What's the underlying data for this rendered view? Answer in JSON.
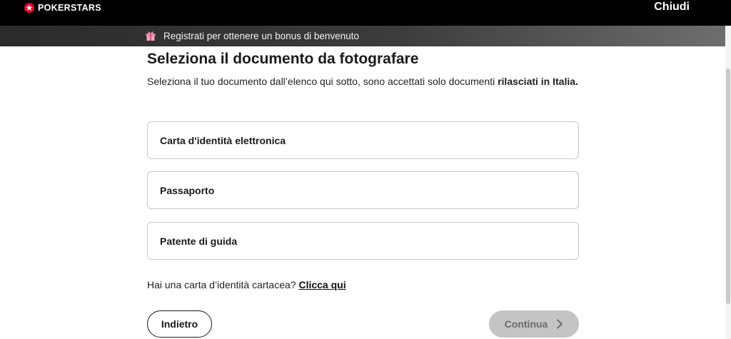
{
  "header": {
    "brand": "POKERSTARS",
    "close_label": "Chiudi"
  },
  "promo": {
    "text": "Registrati per ottenere un bonus di benvenuto"
  },
  "main": {
    "title": "Seleziona il documento da fotografare",
    "description_prefix": "Seleziona il tuo documento dall’elenco qui sotto, sono accettati solo documenti ",
    "description_bold": "rilasciati in Italia.",
    "options": [
      {
        "label": "Carta d'identità elettronica"
      },
      {
        "label": "Passaporto"
      },
      {
        "label": "Patente di guida"
      }
    ],
    "paper_id_question": "Hai una carta d’identità cartacea? ",
    "paper_id_link": "Clicca qui",
    "back_label": "Indietro",
    "continue_label": "Continua"
  },
  "colors": {
    "topbar_bg": "#000000",
    "brand_red": "#e4002b",
    "gift_pink": "#e88aa8",
    "continue_disabled_bg": "#c4c4c4"
  },
  "icons": {
    "brand": "pokerstars-star-icon",
    "promo": "gift-icon",
    "continue": "chevron-right-icon"
  }
}
